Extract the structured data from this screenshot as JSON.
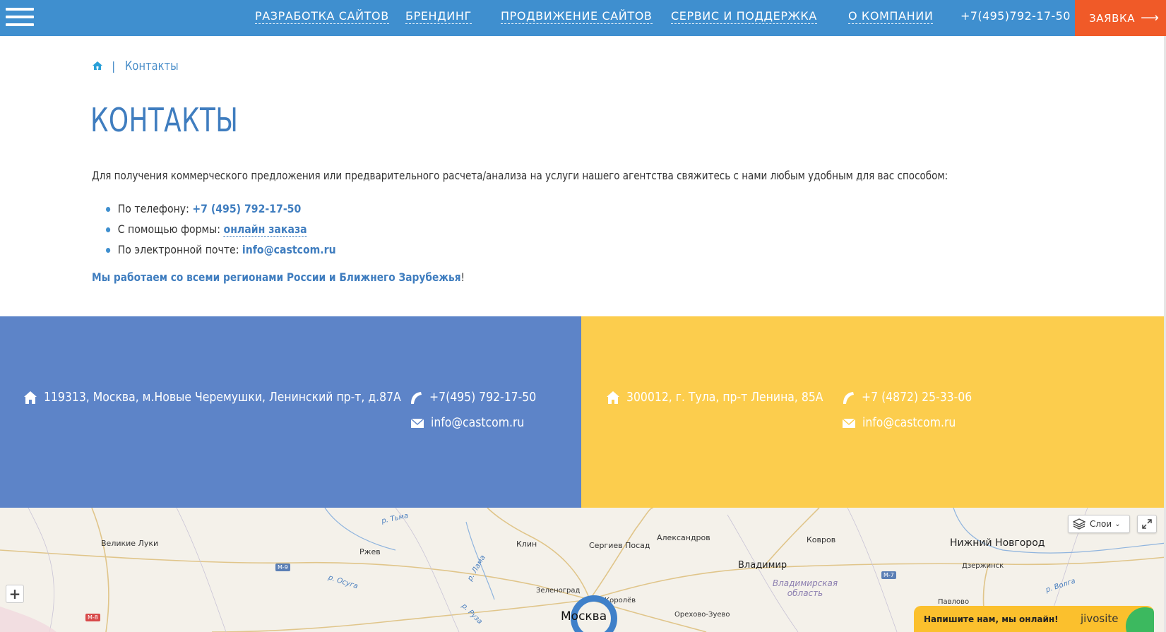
{
  "nav": {
    "items": [
      {
        "label": "РАЗРАБОТКА САЙТОВ"
      },
      {
        "label": "БРЕНДИНГ"
      },
      {
        "label": "ПРОДВИЖЕНИЕ САЙТОВ"
      },
      {
        "label": "СЕРВИС И ПОДДЕРЖКА"
      },
      {
        "label": "О КОМПАНИИ"
      }
    ],
    "phone": "+7(495)792-17-50",
    "order_label": "ЗАЯВКА",
    "order_arrow": "⟶"
  },
  "breadcrumb": {
    "separator": "|",
    "current": "Контакты"
  },
  "page": {
    "title": "КОНТАКТЫ",
    "intro": "Для получения коммерческого предложения или предварительного расчета/анализа на услуги нашего агентства свяжитесь с нами любым удобным для вас способом:",
    "ways": [
      {
        "prefix": "По телефону: ",
        "link": "+7 (495) 792-17-50"
      },
      {
        "prefix": "С помощью формы: ",
        "link": "онлайн заказа"
      },
      {
        "prefix": "По электронной почте: ",
        "link": "info@castcom.ru"
      }
    ],
    "regions": "Мы работаем со всеми регионами России и Ближнего Зарубежья",
    "regions_tail": "!"
  },
  "offices": {
    "moscow": {
      "address": "119313, Москва, м.Новые Черемушки, Ленинский пр-т, д.87А",
      "phone": "+7(495) 792-17-50",
      "email": "info@castcom.ru",
      "color": "#5d84c8"
    },
    "tula": {
      "address": "300012, г. Тула, пр-т Ленина, 85А",
      "phone": "+7 (4872) 25-33-06",
      "email": "info@castcom.ru",
      "color": "#fccd4d"
    }
  },
  "map": {
    "layers_label": "Слои",
    "zoom_in": "+",
    "cities": {
      "velikie_luki": "Великие Луки",
      "rzhev": "Ржев",
      "klin": "Клин",
      "sergiev_posad": "Сергиев Посад",
      "aleksandrov": "Александров",
      "kovrov": "Ковров",
      "nizhny": "Нижний Новгород",
      "vladimir": "Владимир",
      "dzerzhinsk": "Дзержинск",
      "zelenograd": "Зеленоград",
      "korolev": "Королёв",
      "moskva": "Москва",
      "orekhovo": "Орехово-Зуево",
      "pavlovo": "Павлово"
    },
    "rivers": {
      "tma": "р. Тьма",
      "osuga": "р. Осуга",
      "lama": "р. Лама",
      "ruza": "р. Руза",
      "volga": "р. Волга"
    },
    "region_label": "Владимирская область",
    "roads": {
      "m9": "М-9",
      "m7": "М-7",
      "m8": "М-8"
    }
  },
  "chat": {
    "message": "Напишите нам, мы онлайн!",
    "brand": "jivosite"
  },
  "colors": {
    "nav_bg": "#3f8fcf",
    "order_bg": "#f05a28",
    "accent": "#3f7dbf"
  }
}
